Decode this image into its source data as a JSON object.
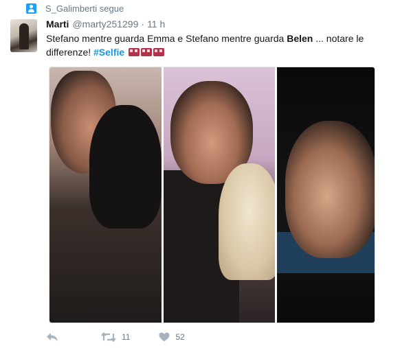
{
  "social_context": {
    "text": "S_Galimberti segue",
    "icon": "person-icon"
  },
  "tweet": {
    "name": "Marti",
    "handle": "@marty251299",
    "dot": "·",
    "time": "11 h",
    "text": {
      "part1": "Stefano mentre guarda Emma e Stefano mentre guarda ",
      "bold": "Belen",
      "part2": " ... notare le differenze! ",
      "hashtag": "#Selfie"
    },
    "emoji_count": 3
  },
  "actions": {
    "reply_icon": "reply-icon",
    "retweet_icon": "retweet-icon",
    "retweet_count": "11",
    "like_icon": "heart-icon",
    "like_count": "52"
  },
  "colors": {
    "link": "#1b95e0",
    "muted": "#657786",
    "text": "#14171a",
    "badge": "#1da1f2"
  }
}
